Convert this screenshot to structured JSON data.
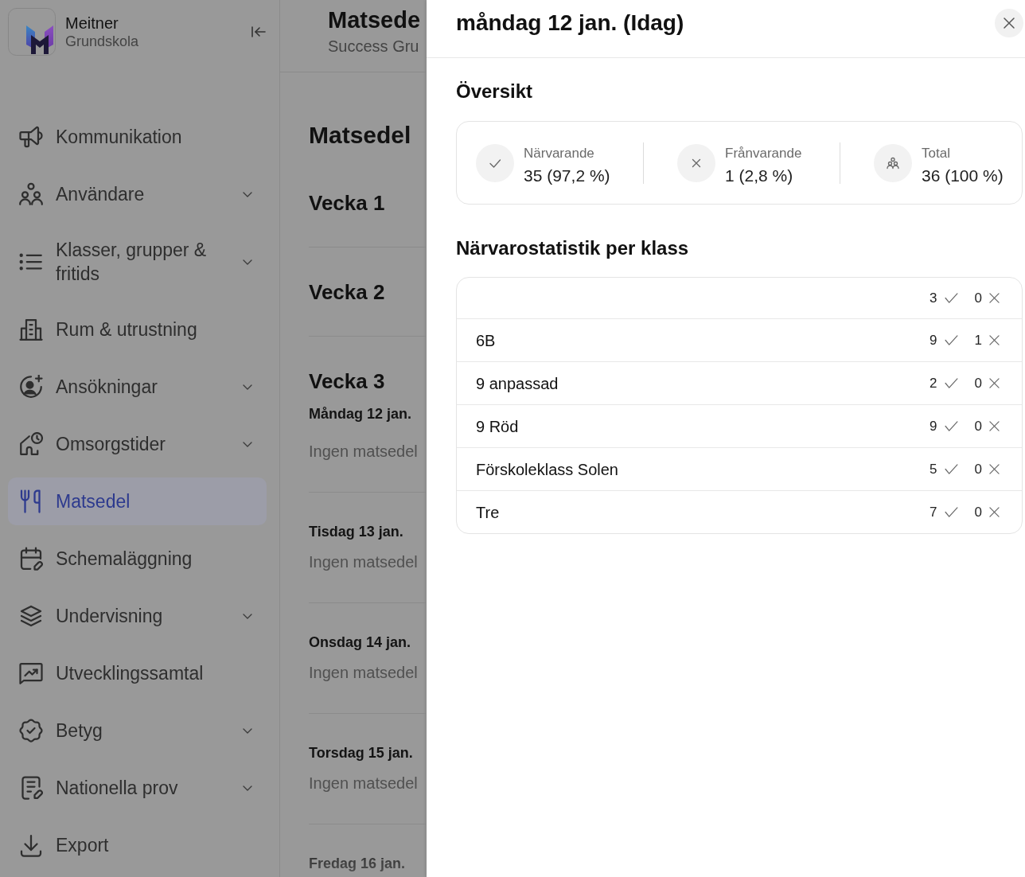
{
  "sidebar": {
    "brand": {
      "name": "Meitner",
      "subtitle": "Grundskola"
    },
    "items": [
      {
        "label": "Kommunikation",
        "has_submenu": false,
        "selected": false
      },
      {
        "label": "Användare",
        "has_submenu": true,
        "selected": false
      },
      {
        "label": "Klasser, grupper & fritids",
        "has_submenu": true,
        "selected": false
      },
      {
        "label": "Rum & utrustning",
        "has_submenu": false,
        "selected": false
      },
      {
        "label": "Ansökningar",
        "has_submenu": true,
        "selected": false
      },
      {
        "label": "Omsorgstider",
        "has_submenu": true,
        "selected": false
      },
      {
        "label": "Matsedel",
        "has_submenu": false,
        "selected": true
      },
      {
        "label": "Schemaläggning",
        "has_submenu": false,
        "selected": false
      },
      {
        "label": "Undervisning",
        "has_submenu": true,
        "selected": false
      },
      {
        "label": "Utvecklingssamtal",
        "has_submenu": false,
        "selected": false
      },
      {
        "label": "Betyg",
        "has_submenu": true,
        "selected": false
      },
      {
        "label": "Nationella prov",
        "has_submenu": true,
        "selected": false
      },
      {
        "label": "Export",
        "has_submenu": false,
        "selected": false
      }
    ]
  },
  "main": {
    "header": {
      "title": "Matsede",
      "subtitle": "Success Gru"
    },
    "heading": "Matsedel",
    "weeks": [
      {
        "label": "Vecka 1"
      },
      {
        "label": "Vecka 2"
      },
      {
        "label": "Vecka 3",
        "days": [
          {
            "label": "Måndag 12 jan.",
            "note": "Ingen matsedel"
          },
          {
            "label": "Tisdag 13 jan.",
            "note": "Ingen matsedel"
          },
          {
            "label": "Onsdag 14 jan.",
            "note": "Ingen matsedel"
          },
          {
            "label": "Torsdag 15 jan.",
            "note": "Ingen matsedel"
          },
          {
            "label": "Fredag 16 jan."
          }
        ]
      }
    ]
  },
  "day_panel": {
    "title": "måndag 12 jan. (Idag)",
    "overview": {
      "heading": "Översikt",
      "stats": [
        {
          "kind": "present",
          "label": "Närvarande",
          "value": "35 (97,2 %)"
        },
        {
          "kind": "absent",
          "label": "Frånvarande",
          "value": "1 (2,8 %)"
        },
        {
          "kind": "total",
          "label": "Total",
          "value": "36 (100 %)"
        }
      ]
    },
    "class_stats": {
      "heading": "Närvarostatistik per klass",
      "rows": [
        {
          "present": "3",
          "absent": "0"
        },
        {
          "name": "6B",
          "present": "9",
          "absent": "1"
        },
        {
          "name": "9 anpassad",
          "present": "2",
          "absent": "0"
        },
        {
          "name": "9 Röd",
          "present": "9",
          "absent": "0"
        },
        {
          "name": "Förskoleklass Solen",
          "present": "5",
          "absent": "0"
        },
        {
          "name": "Tre",
          "present": "7",
          "absent": "0"
        }
      ]
    }
  }
}
